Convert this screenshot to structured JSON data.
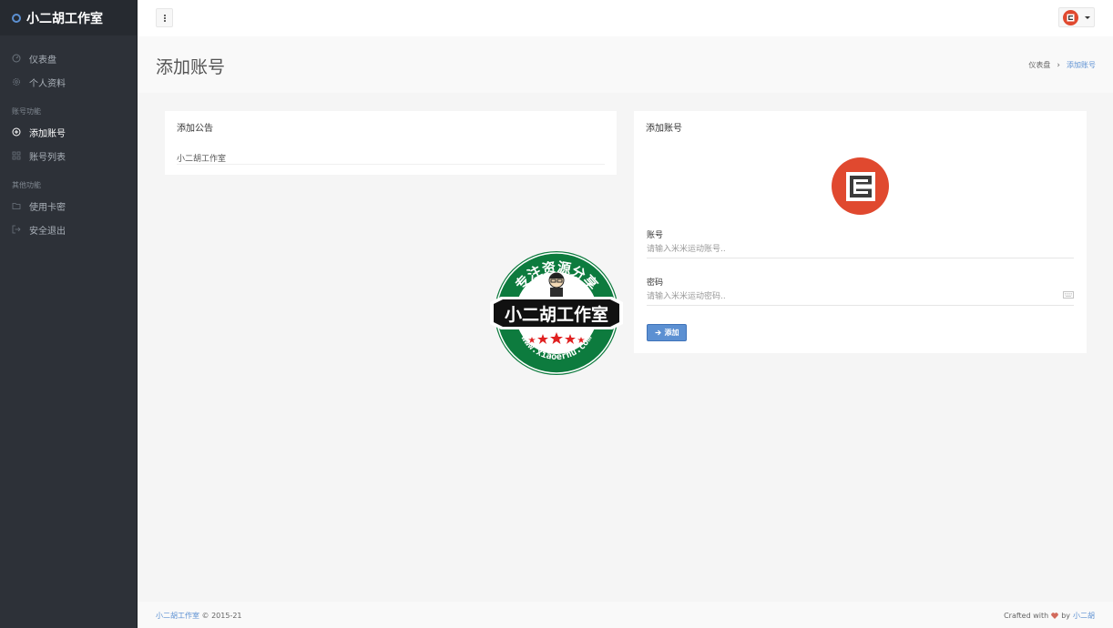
{
  "brand": {
    "title": "小二胡工作室"
  },
  "sidebar": {
    "items": [
      {
        "label": "仪表盘",
        "icon": "dashboard-icon"
      },
      {
        "label": "个人资料",
        "icon": "gear-icon"
      }
    ],
    "section_account": "账号功能",
    "account_items": [
      {
        "label": "添加账号",
        "icon": "plus-circle-icon",
        "active": true
      },
      {
        "label": "账号列表",
        "icon": "grid-icon"
      }
    ],
    "section_other": "其他功能",
    "other_items": [
      {
        "label": "使用卡密",
        "icon": "folder-icon"
      },
      {
        "label": "安全退出",
        "icon": "logout-icon"
      }
    ]
  },
  "header": {
    "page_title": "添加账号",
    "breadcrumb": {
      "home": "仪表盘",
      "separator": "›",
      "current": "添加账号"
    }
  },
  "notice": {
    "title": "添加公告",
    "text": "小二胡工作室"
  },
  "form": {
    "title": "添加账号",
    "account_label": "账号",
    "account_placeholder": "请输入米米运动账号..",
    "password_label": "密码",
    "password_placeholder": "请输入米米运动密码..",
    "submit_label": "添加"
  },
  "watermark": {
    "top_text": "专注资源分享",
    "center_text": "小二胡工作室",
    "bottom_text": "www.xiaoerhu.com"
  },
  "footer": {
    "brand": "小二胡工作室",
    "copyright": "© 2015-21",
    "crafted": "Crafted with",
    "by": "by",
    "author": "小二胡"
  },
  "colors": {
    "accent": "#5c90d2",
    "sidebar_bg": "#2d3138",
    "logo_red": "#e0492f"
  }
}
